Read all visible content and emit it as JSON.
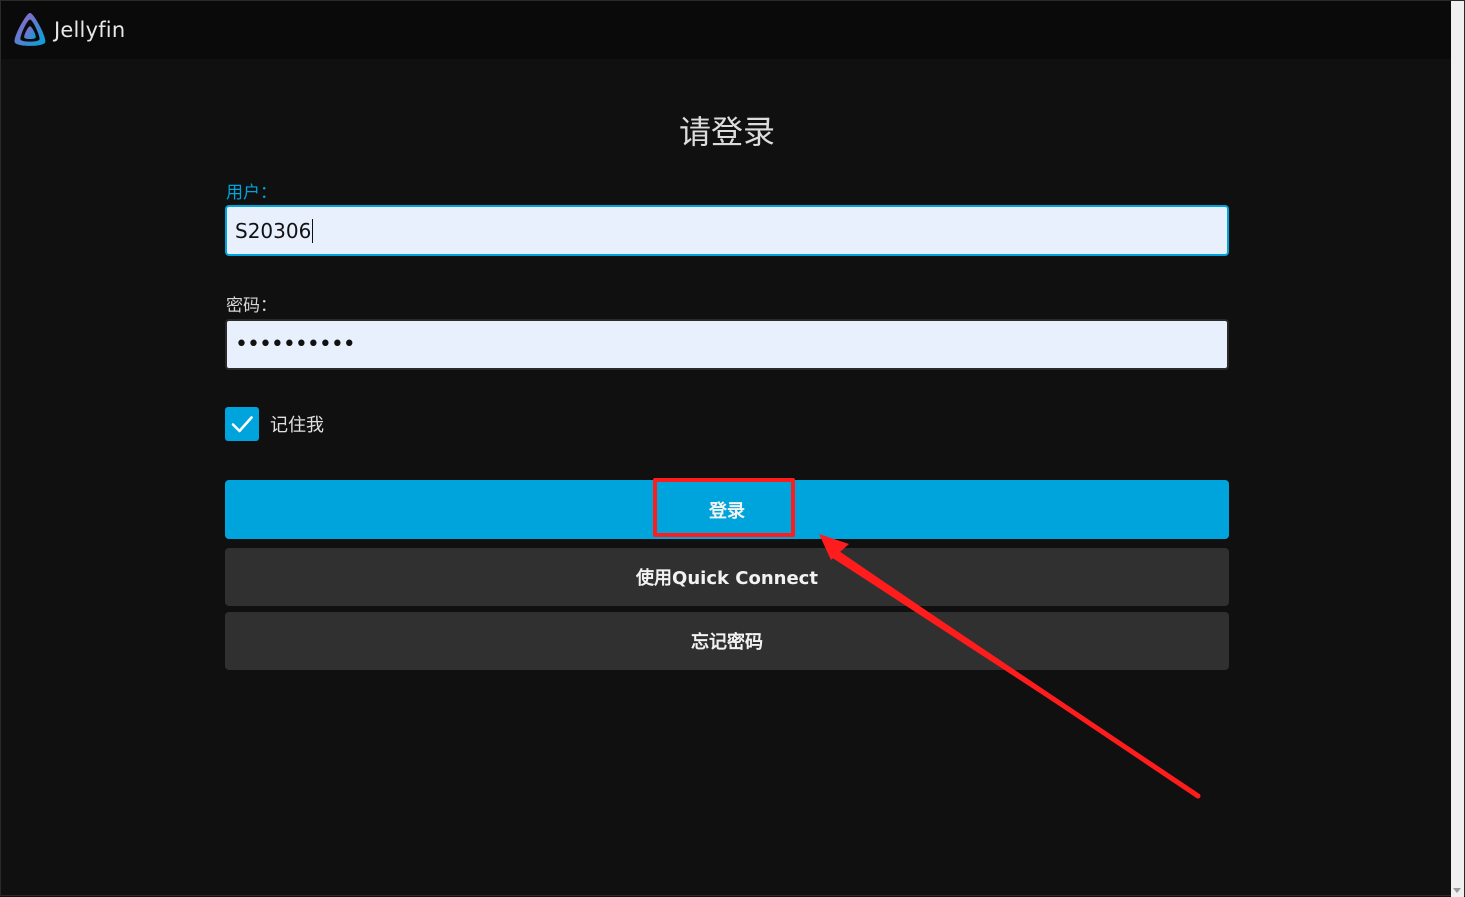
{
  "app": {
    "name": "Jellyfin",
    "logo_icon": "jellyfin-logo-icon"
  },
  "login": {
    "title": "请登录",
    "username_label": "用户：",
    "username_value": "S20306",
    "password_label": "密码：",
    "password_value": "••••••••••",
    "remember_label": "记住我",
    "remember_checked": true,
    "login_button": "登录",
    "quick_connect_button": "使用Quick Connect",
    "forgot_password_button": "忘记密码"
  },
  "colors": {
    "accent": "#00a4dc",
    "background": "#101010",
    "header": "#0a0a0a",
    "secondary_button": "#303030",
    "annotation": "#ff1c1c"
  }
}
